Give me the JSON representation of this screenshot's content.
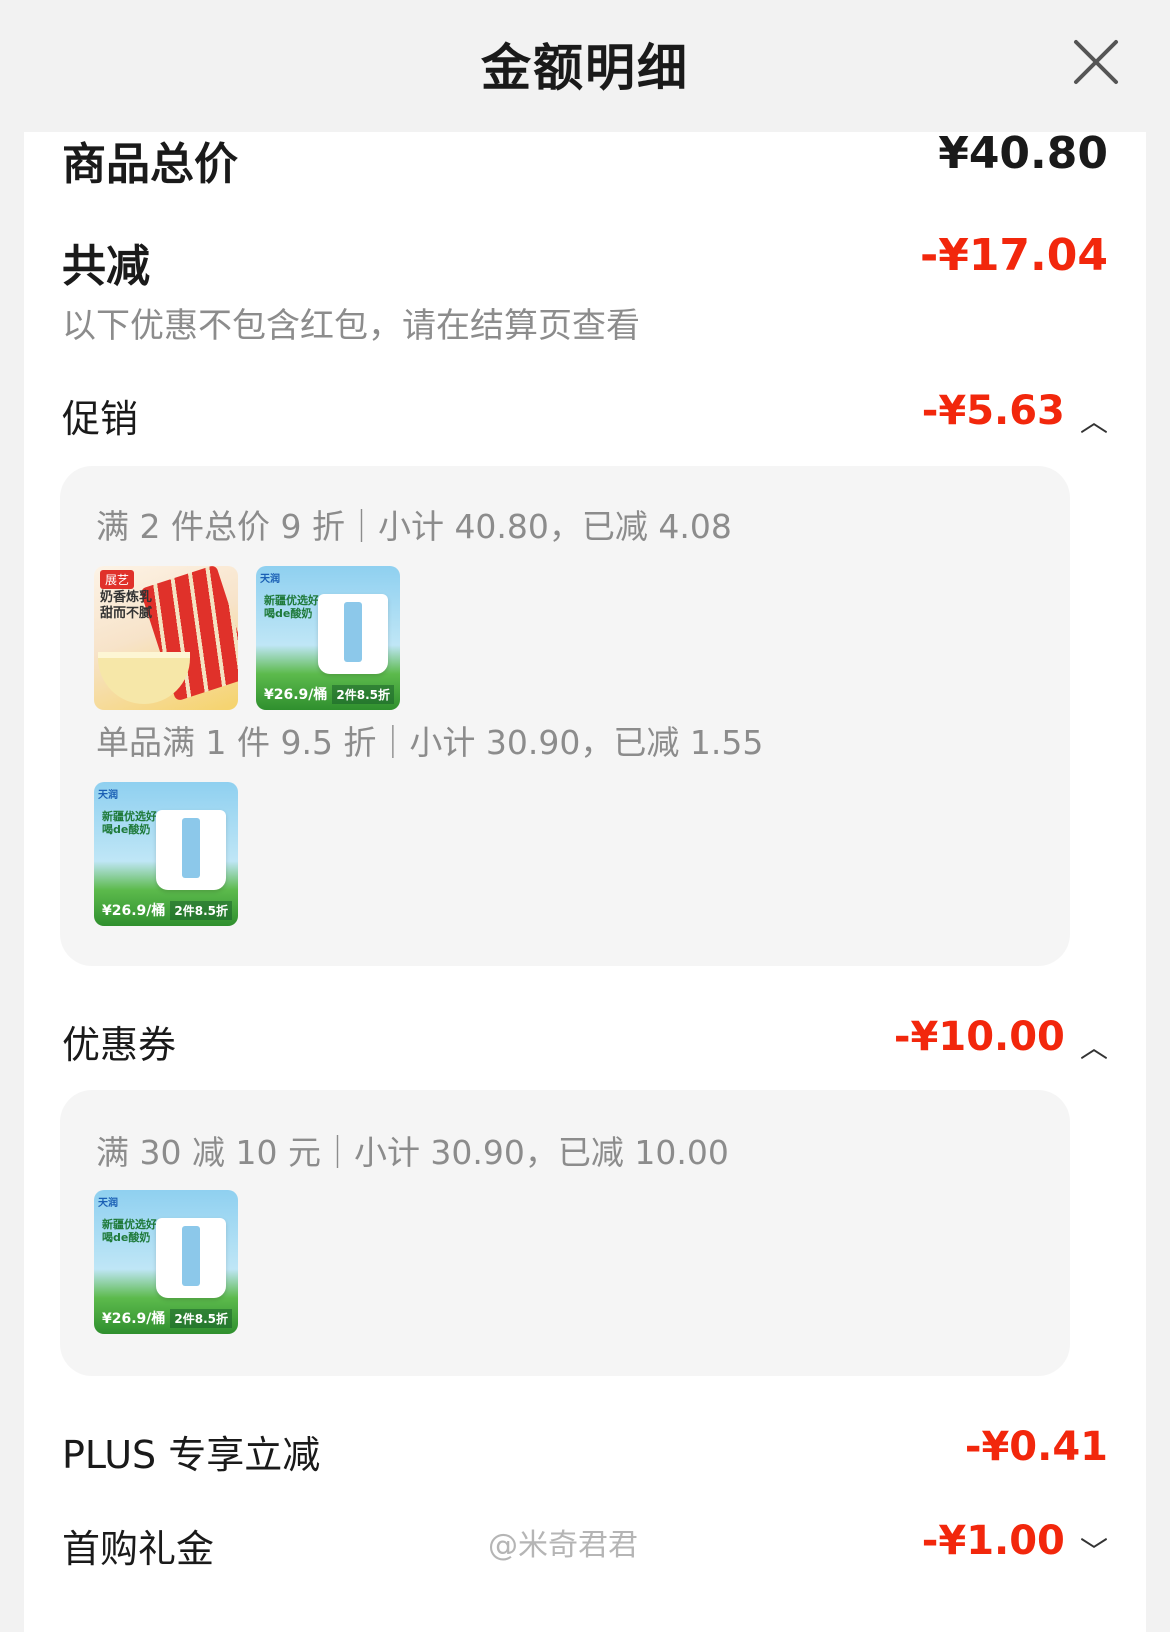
{
  "header": {
    "title": "金额明细"
  },
  "summary": {
    "goods_total_label": "商品总价",
    "goods_total_value": "¥40.80",
    "total_discount_label": "共减",
    "total_discount_value": "-¥17.04",
    "note": "以下优惠不包含红包，请在结算页查看"
  },
  "promotion": {
    "label": "促销",
    "value": "-¥5.63",
    "rules": [
      {
        "text": "满 2 件总价 9 折｜小计 40.80，已减 4.08",
        "items": [
          "condensed-milk",
          "yogurt"
        ]
      },
      {
        "text": "单品满 1 件 9.5 折｜小计 30.90，已减 1.55",
        "items": [
          "yogurt"
        ]
      }
    ]
  },
  "coupon": {
    "label": "优惠券",
    "value": "-¥10.00",
    "rules": [
      {
        "text": "满 30 减 10 元｜小计 30.90，已减 10.00",
        "items": [
          "yogurt"
        ]
      }
    ]
  },
  "plus": {
    "label": "PLUS 专享立减",
    "value": "-¥0.41"
  },
  "first_gift": {
    "label": "首购礼金",
    "value": "-¥1.00"
  },
  "products": {
    "milk": {
      "tag": "展艺",
      "slogan": "奶香炼乳甜而不腻"
    },
    "yogurt": {
      "brand": "天润",
      "text": "新疆优选好喝de酸奶",
      "price": "¥26.9/桶",
      "deal": "2件8.5折"
    }
  },
  "watermark": "@米奇君君",
  "colors": {
    "accent_red": "#f2270c",
    "muted_text": "#8c8c8c",
    "panel_bg": "#f5f5f5"
  }
}
